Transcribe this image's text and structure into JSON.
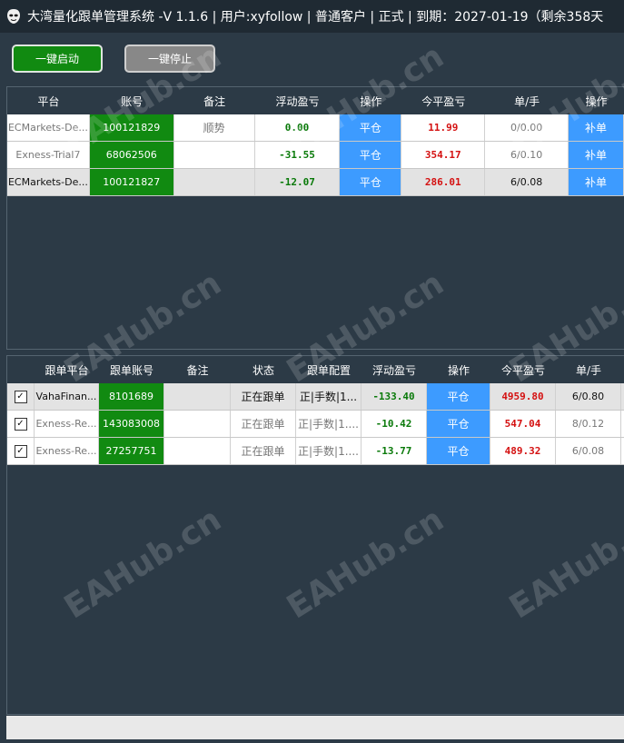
{
  "window": {
    "title": "大湾量化跟单管理系统 -V  1.1.6  | 用户:xyfollow | 普通客户 | 正式  | 到期：2027-01-19（剩余358天"
  },
  "toolbar": {
    "start_label": "一键启动",
    "stop_label": "一键停止"
  },
  "master": {
    "headers": [
      "平台",
      "账号",
      "备注",
      "浮动盈亏",
      "操作",
      "今平盈亏",
      "单/手",
      "操作"
    ],
    "rows": [
      {
        "platform": "ECMarkets-De...",
        "account": "100121829",
        "note": "顺势",
        "float_pl": "0.00",
        "close_label": "平仓",
        "today_pl": "11.99",
        "orders": "0/0.00",
        "add_label": "补单"
      },
      {
        "platform": "Exness-Trial7",
        "account": "68062506",
        "note": "",
        "float_pl": "-31.55",
        "close_label": "平仓",
        "today_pl": "354.17",
        "orders": "6/0.10",
        "add_label": "补单"
      },
      {
        "platform": "ECMarkets-De...",
        "account": "100121827",
        "note": "",
        "float_pl": "-12.07",
        "close_label": "平仓",
        "today_pl": "286.01",
        "orders": "6/0.08",
        "add_label": "补单"
      }
    ]
  },
  "follower": {
    "headers": [
      "跟单平台",
      "跟单账号",
      "备注",
      "状态",
      "跟单配置",
      "浮动盈亏",
      "操作",
      "今平盈亏",
      "单/手"
    ],
    "rows": [
      {
        "checked": true,
        "platform": "VahaFinan...",
        "account": "8101689",
        "note": "",
        "status": "正在跟单",
        "config": "正|手数|1...",
        "float_pl": "-133.40",
        "close_label": "平仓",
        "today_pl": "4959.80",
        "orders": "6/0.80"
      },
      {
        "checked": true,
        "platform": "Exness-Re...",
        "account": "143083008",
        "note": "",
        "status": "正在跟单",
        "config": "正|手数|1....",
        "float_pl": "-10.42",
        "close_label": "平仓",
        "today_pl": "547.04",
        "orders": "8/0.12"
      },
      {
        "checked": true,
        "platform": "Exness-Re...",
        "account": "27257751",
        "note": "",
        "status": "正在跟单",
        "config": "正|手数|1....",
        "float_pl": "-13.77",
        "close_label": "平仓",
        "today_pl": "489.32",
        "orders": "6/0.08"
      }
    ]
  },
  "watermark": {
    "text": "EAHub.cn"
  },
  "colors": {
    "accent_green": "#118a11",
    "button_blue": "#3d9bff",
    "profit_red": "#d41010",
    "loss_green": "#0a7a0a"
  }
}
